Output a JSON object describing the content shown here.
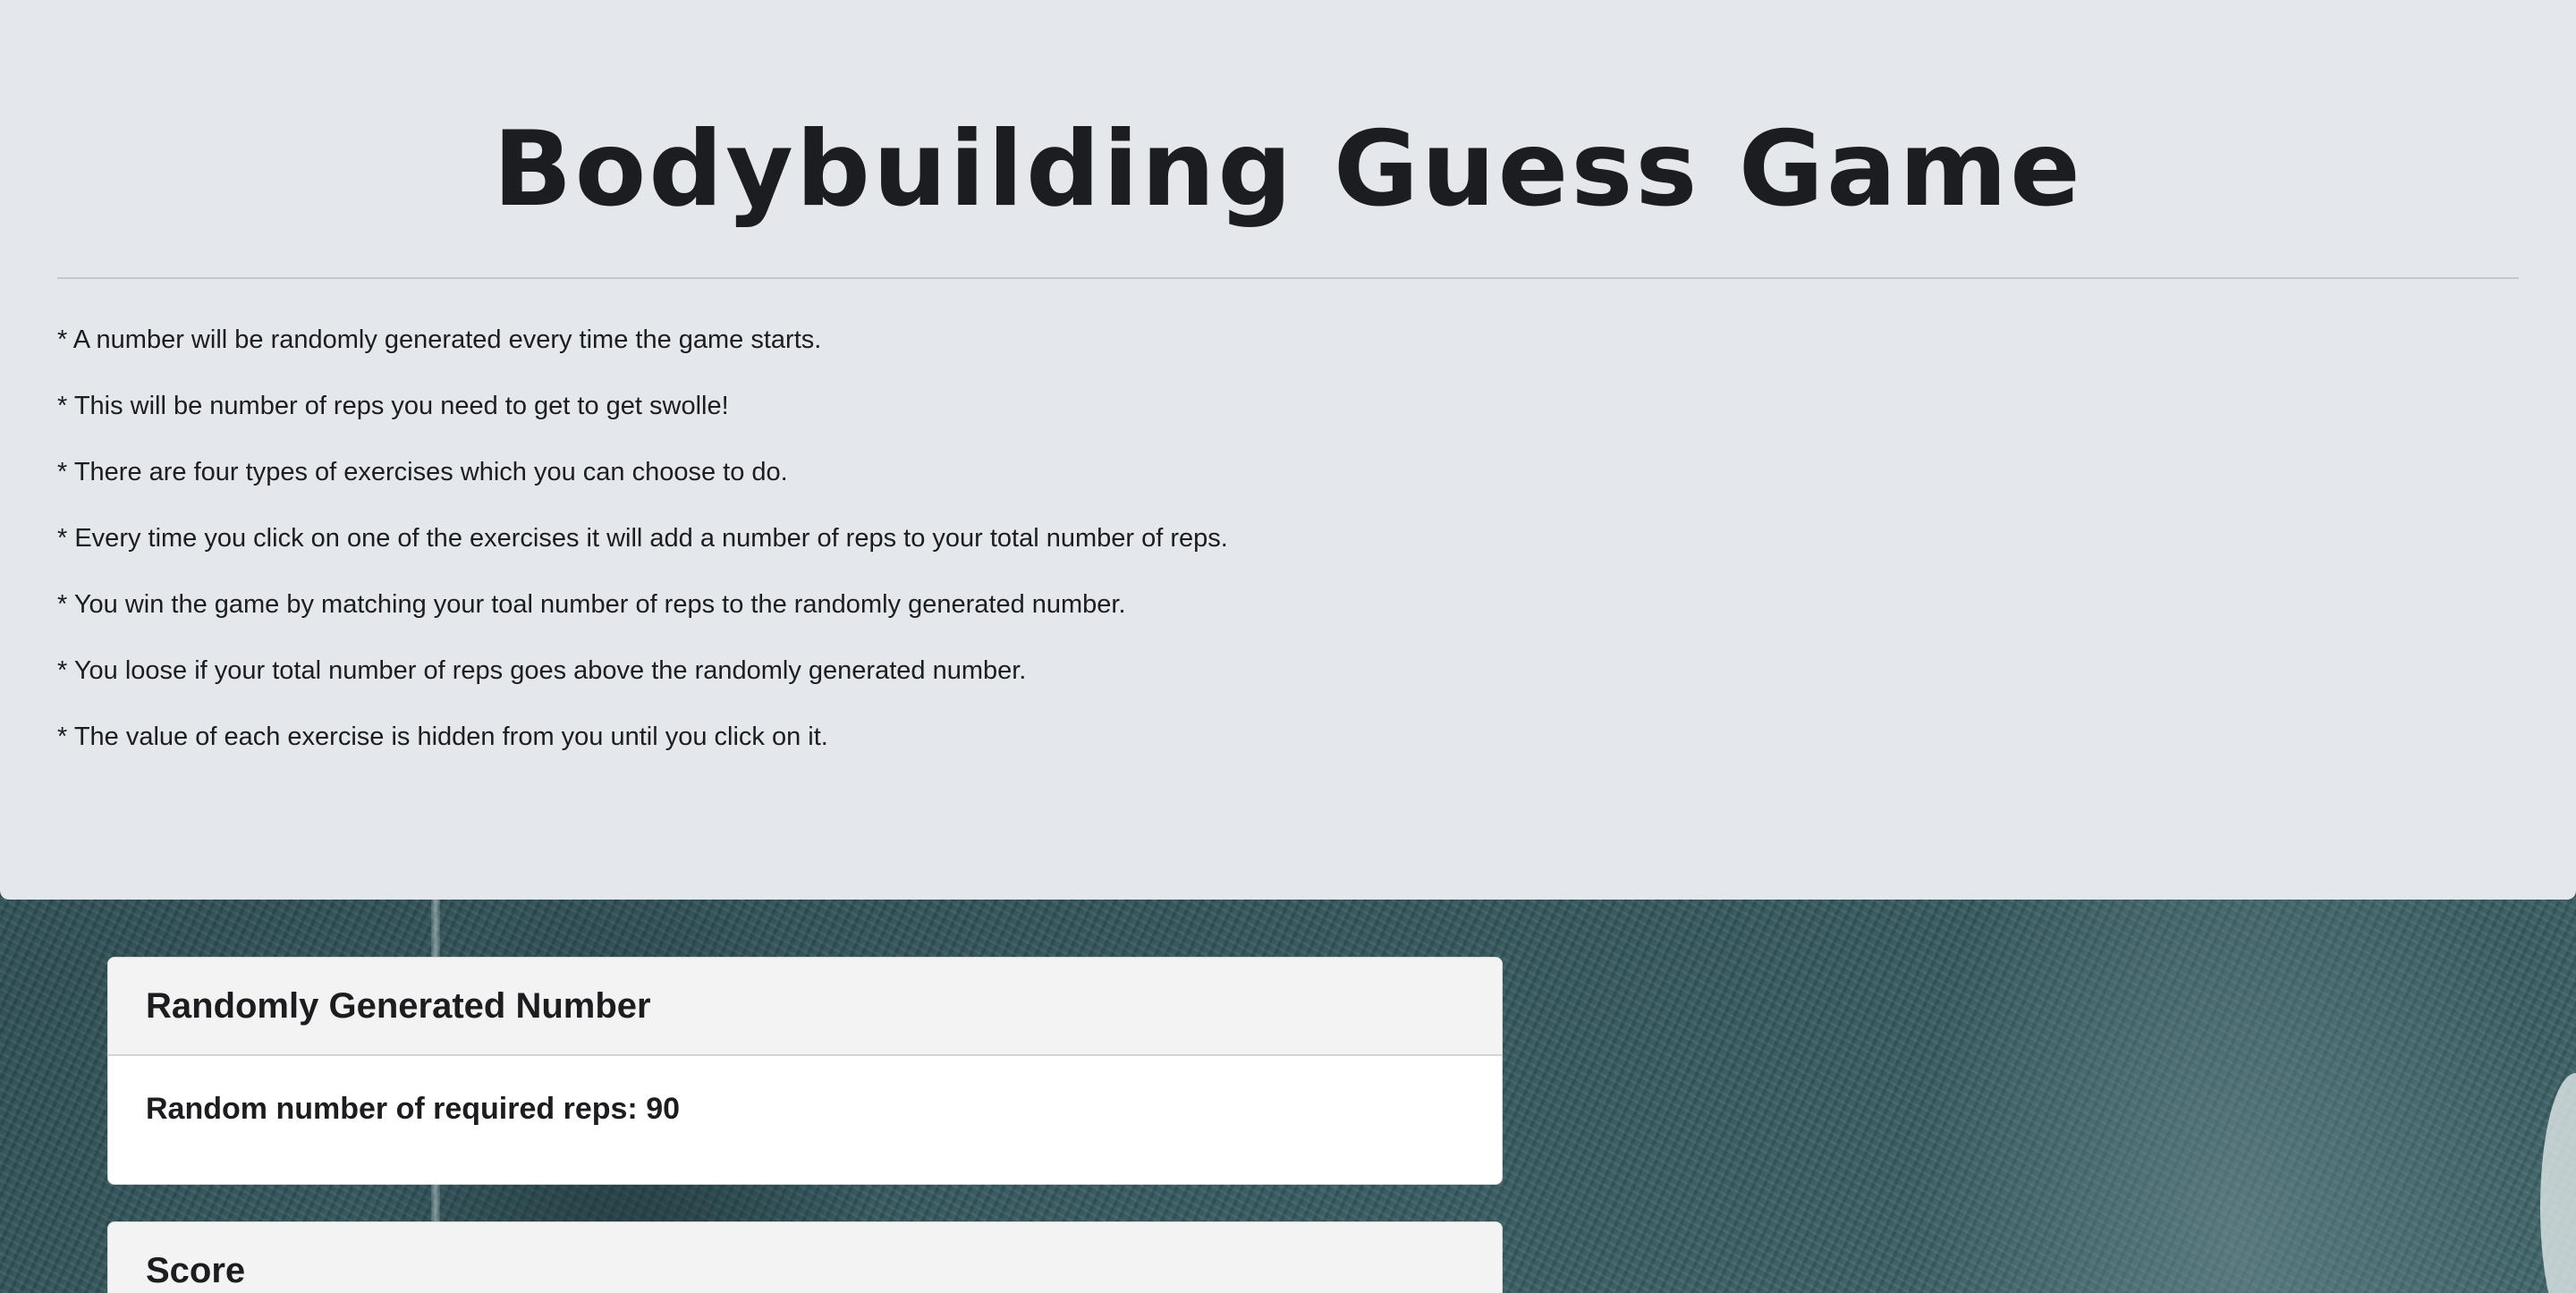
{
  "header": {
    "title": "Bodybuilding Guess Game",
    "rules": [
      "* A number will be randomly generated every time the game starts.",
      "* This will be number of reps you need to get to get swolle!",
      "* There are four types of exercises which you can choose to do.",
      "* Every time you click on one of the exercises it will add a number of reps to your total number of reps.",
      "* You win the game by matching your toal number of reps to the randomly generated number.",
      "* You loose if your total number of reps goes above the randomly generated number.",
      "* The value of each exercise is hidden from you until you click on it."
    ]
  },
  "random_card": {
    "title": "Randomly Generated Number",
    "label": "Random number of required reps: ",
    "value": "90"
  },
  "score_card": {
    "title": "Score"
  },
  "colors": {
    "panel": "#e4e7ec",
    "text": "#1c1d21",
    "card_header": "#f3f3f4",
    "background": "#385b61"
  }
}
